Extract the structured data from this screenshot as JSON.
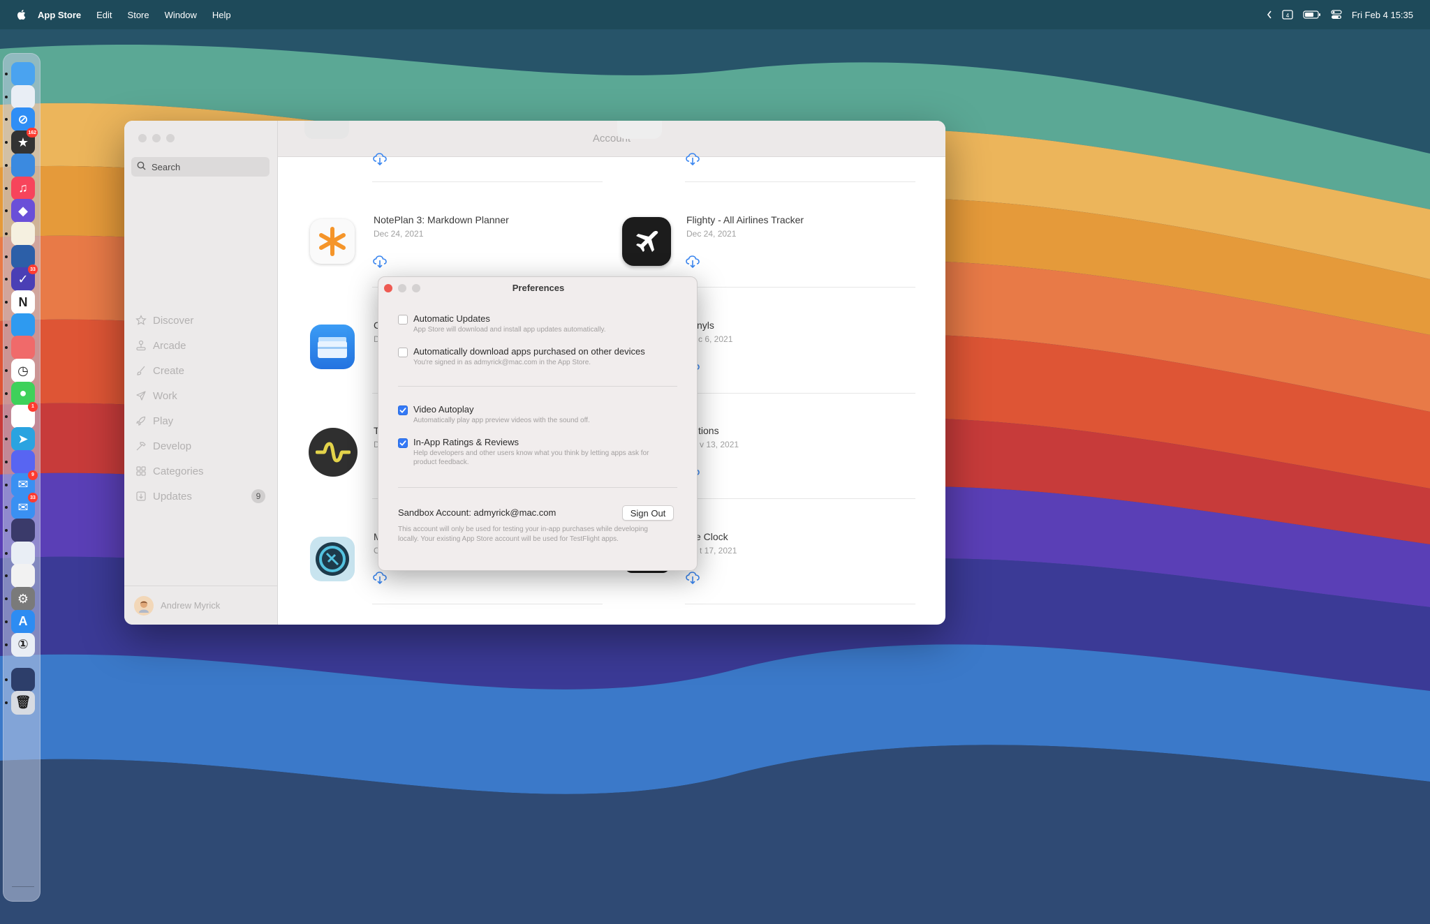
{
  "menubar": {
    "app_name": "App Store",
    "menus": [
      "Edit",
      "Store",
      "Window",
      "Help"
    ],
    "datetime": "Fri Feb 4  15:35"
  },
  "dock": {
    "apps": [
      {
        "name": "finder-icon",
        "color": "#4aa3f0",
        "badge": ""
      },
      {
        "name": "launchpad-icon",
        "color": "#e9eef5",
        "badge": ""
      },
      {
        "name": "safari-icon",
        "color": "#2f8ef5",
        "badge": ""
      },
      {
        "name": "reeder-icon",
        "color": "#333333",
        "badge": "162"
      },
      {
        "name": "tweetbot-icon",
        "color": "#3b8ae0",
        "badge": ""
      },
      {
        "name": "music-icon",
        "color": "#f7445b",
        "badge": ""
      },
      {
        "name": "obsidian-icon",
        "color": "#6a4fd8",
        "badge": ""
      },
      {
        "name": "notes-icon",
        "color": "#f5f0e0",
        "badge": ""
      },
      {
        "name": "screens-icon",
        "color": "#2c5fa8",
        "badge": ""
      },
      {
        "name": "omnifocus-icon",
        "color": "#4a3fb5",
        "badge": "33"
      },
      {
        "name": "notion-icon",
        "color": "#ffffff",
        "badge": ""
      },
      {
        "name": "spark-icon",
        "color": "#2e9af0",
        "badge": ""
      },
      {
        "name": "asana-icon",
        "color": "#f06a6a",
        "badge": ""
      },
      {
        "name": "clock-icon",
        "color": "#ffffff",
        "badge": ""
      },
      {
        "name": "messages-icon",
        "color": "#3ed15a",
        "badge": ""
      },
      {
        "name": "slack-icon",
        "color": "#ffffff",
        "badge": "1"
      },
      {
        "name": "telegram-icon",
        "color": "#2aa3e0",
        "badge": ""
      },
      {
        "name": "discord-icon",
        "color": "#5865f2",
        "badge": ""
      },
      {
        "name": "mail-icon",
        "color": "#3a90f2",
        "badge": "9"
      },
      {
        "name": "airmail-icon",
        "color": "#3a90f2",
        "badge": "33"
      },
      {
        "name": "shortcuts-icon",
        "color": "#3a3a6a",
        "badge": ""
      },
      {
        "name": "preview-icon",
        "color": "#e9eef5",
        "badge": ""
      },
      {
        "name": "pixelmator-icon",
        "color": "#f2f2f2",
        "badge": ""
      },
      {
        "name": "system-preferences-icon",
        "color": "#7a7a7a",
        "badge": ""
      },
      {
        "name": "app-store-icon",
        "color": "#2d8cf2",
        "badge": ""
      },
      {
        "name": "1password-icon",
        "color": "#e9eef5",
        "badge": ""
      },
      {
        "name": "downloads-icon",
        "color": "#2d3e6a",
        "badge": ""
      },
      {
        "name": "trash-icon",
        "color": "#d7dbe2",
        "badge": ""
      }
    ]
  },
  "window": {
    "title": "Account",
    "search_placeholder": "Search",
    "nav": [
      {
        "label": "Discover",
        "icon": "star-icon"
      },
      {
        "label": "Arcade",
        "icon": "joystick-icon"
      },
      {
        "label": "Create",
        "icon": "brush-icon"
      },
      {
        "label": "Work",
        "icon": "paperplane-icon"
      },
      {
        "label": "Play",
        "icon": "rocket-icon"
      },
      {
        "label": "Develop",
        "icon": "hammer-icon"
      },
      {
        "label": "Categories",
        "icon": "grid-icon"
      },
      {
        "label": "Updates",
        "icon": "download-icon",
        "badge": "9"
      }
    ],
    "user_name": "Andrew Myrick",
    "apps_left": [
      {
        "name": "NotePlan 3: Markdown Planner",
        "date": "Dec 24, 2021"
      },
      {
        "name": "C",
        "date": "D"
      },
      {
        "name": "T",
        "date": "D"
      },
      {
        "name": "M",
        "date": "O"
      }
    ],
    "apps_right": [
      {
        "name": "Flighty - All Airlines Tracker",
        "date": "Dec 24, 2021"
      },
      {
        "name": "nyls",
        "date": "c 6, 2021"
      },
      {
        "name": "tions",
        "date": "v 13, 2021"
      },
      {
        "name": "e Clock",
        "date": "t 17, 2021"
      }
    ]
  },
  "preferences": {
    "title": "Preferences",
    "options": [
      {
        "label": "Automatic Updates",
        "desc": "App Store will download and install app updates automatically.",
        "checked": false
      },
      {
        "label": "Automatically download apps purchased on other devices",
        "desc": "You're signed in as admyrick@mac.com in the App Store.",
        "checked": false
      },
      {
        "label": "Video Autoplay",
        "desc": "Automatically play app preview videos with the sound off.",
        "checked": true
      },
      {
        "label": "In-App Ratings & Reviews",
        "desc": "Help developers and other users know what you think by letting apps ask for product feedback.",
        "checked": true
      }
    ],
    "sandbox_label": "Sandbox Account: admyrick@mac.com",
    "sign_out": "Sign Out",
    "sandbox_desc": "This account will only be used for testing your in-app purchases while developing locally. Your existing App Store account will be used for TestFlight apps."
  },
  "colors": {
    "accent": "#3479f6",
    "close": "#ee5a52"
  }
}
